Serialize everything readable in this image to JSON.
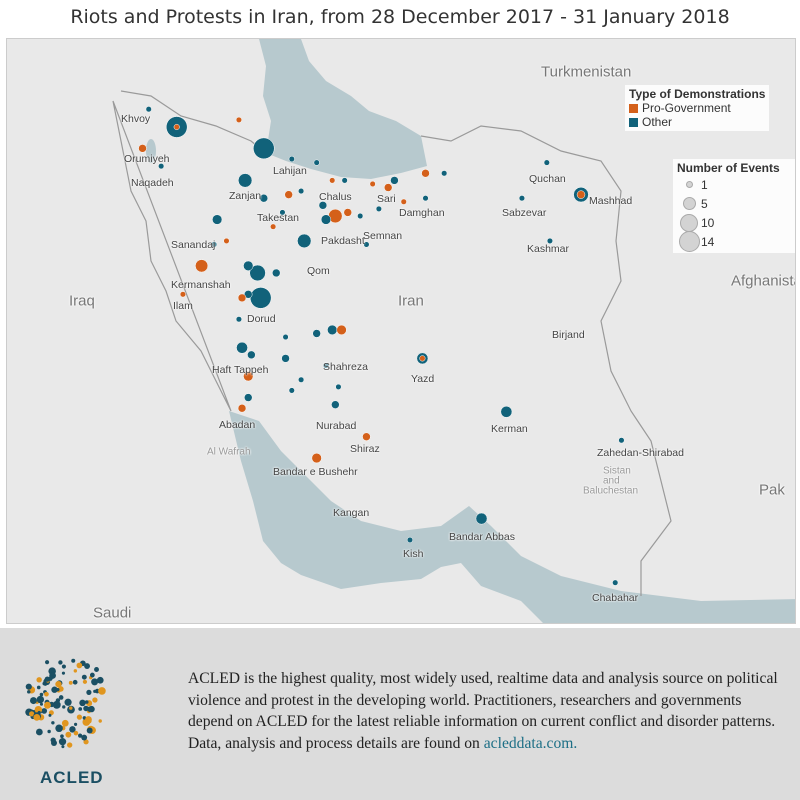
{
  "title": "Riots and Protests in Iran, from 28 December 2017 - 31 January 2018",
  "colors": {
    "pro_government": "#d4601a",
    "other": "#11627a",
    "water": "#b7c9ce",
    "land": "#e9e9e9"
  },
  "legend_type": {
    "title": "Type of Demonstrations",
    "items": [
      {
        "label": "Pro-Government",
        "key": "pro_government"
      },
      {
        "label": "Other",
        "key": "other"
      }
    ]
  },
  "legend_size": {
    "title": "Number of Events",
    "items": [
      {
        "label": "1",
        "value": 1
      },
      {
        "label": "5",
        "value": 5
      },
      {
        "label": "10",
        "value": 10
      },
      {
        "label": "14",
        "value": 14
      }
    ]
  },
  "labels": {
    "countries": [
      "Iraq",
      "Iran",
      "Saudi",
      "Pak",
      "Afghanista",
      "Turkmenistan"
    ],
    "regions": [
      "Al Wafrah",
      "Sistan",
      "and",
      "Baluchestan"
    ],
    "cities": [
      "Khvoy",
      "Orumiyeh",
      "Naqadeh",
      "Lahijan",
      "Zanjan",
      "Chalus",
      "Sari",
      "Damghan",
      "Takestan",
      "Pakdasht",
      "Semnan",
      "Sanandaj",
      "Qom",
      "Kermanshah",
      "Ilam",
      "Dorud",
      "Haft Tappeh",
      "Shahreza",
      "Yazd",
      "Abadan",
      "Nurabad",
      "Shiraz",
      "Bandar e Bushehr",
      "Kerman",
      "Zahedan-Shirabad",
      "Kangan",
      "Bandar Abbas",
      "Kish",
      "Chabahar",
      "Quchan",
      "Sabzevar",
      "Mashhad",
      "Kashmar",
      "Birjand"
    ]
  },
  "events": [
    {
      "lon": 46.6,
      "lat": 38.2,
      "type": "other",
      "count": 14
    },
    {
      "lon": 49.4,
      "lat": 37.6,
      "type": "other",
      "count": 14
    },
    {
      "lon": 49.3,
      "lat": 33.4,
      "type": "other",
      "count": 14
    },
    {
      "lon": 49.2,
      "lat": 34.1,
      "type": "other",
      "count": 8
    },
    {
      "lon": 48.8,
      "lat": 36.7,
      "type": "other",
      "count": 6
    },
    {
      "lon": 47.4,
      "lat": 34.3,
      "type": "pro_government",
      "count": 5
    },
    {
      "lon": 59.6,
      "lat": 36.3,
      "type": "other",
      "count": 7
    },
    {
      "lon": 51.7,
      "lat": 35.7,
      "type": "pro_government",
      "count": 6
    },
    {
      "lon": 50.7,
      "lat": 35.0,
      "type": "other",
      "count": 6
    },
    {
      "lon": 56.4,
      "lat": 27.2,
      "type": "other",
      "count": 4
    },
    {
      "lon": 57.2,
      "lat": 30.2,
      "type": "other",
      "count": 4
    },
    {
      "lon": 54.5,
      "lat": 31.7,
      "type": "other",
      "count": 4
    },
    {
      "lon": 51.6,
      "lat": 32.5,
      "type": "other",
      "count": 3
    },
    {
      "lon": 51.9,
      "lat": 32.5,
      "type": "pro_government",
      "count": 3
    },
    {
      "lon": 47.9,
      "lat": 35.6,
      "type": "other",
      "count": 3
    },
    {
      "lon": 48.9,
      "lat": 34.3,
      "type": "other",
      "count": 3
    },
    {
      "lon": 49.8,
      "lat": 34.1,
      "type": "other",
      "count": 2
    },
    {
      "lon": 48.7,
      "lat": 32.0,
      "type": "other",
      "count": 4
    },
    {
      "lon": 49.0,
      "lat": 31.8,
      "type": "other",
      "count": 2
    },
    {
      "lon": 50.1,
      "lat": 31.7,
      "type": "other",
      "count": 2
    },
    {
      "lon": 48.9,
      "lat": 31.2,
      "type": "pro_government",
      "count": 3
    },
    {
      "lon": 48.9,
      "lat": 30.6,
      "type": "other",
      "count": 2
    },
    {
      "lon": 48.7,
      "lat": 30.3,
      "type": "pro_government",
      "count": 2
    },
    {
      "lon": 51.7,
      "lat": 30.4,
      "type": "other",
      "count": 2
    },
    {
      "lon": 52.7,
      "lat": 29.5,
      "type": "pro_government",
      "count": 2
    },
    {
      "lon": 51.1,
      "lat": 28.9,
      "type": "pro_government",
      "count": 3
    },
    {
      "lon": 51.8,
      "lat": 30.9,
      "type": "other",
      "count": 1
    },
    {
      "lon": 51.1,
      "lat": 32.4,
      "type": "other",
      "count": 2
    },
    {
      "lon": 50.3,
      "lat": 30.8,
      "type": "other",
      "count": 1
    },
    {
      "lon": 53.6,
      "lat": 36.7,
      "type": "other",
      "count": 2
    },
    {
      "lon": 53.4,
      "lat": 36.5,
      "type": "pro_government",
      "count": 2
    },
    {
      "lon": 52.9,
      "lat": 36.6,
      "type": "pro_government",
      "count": 1
    },
    {
      "lon": 53.9,
      "lat": 36.1,
      "type": "pro_government",
      "count": 1
    },
    {
      "lon": 54.6,
      "lat": 36.2,
      "type": "other",
      "count": 1
    },
    {
      "lon": 54.6,
      "lat": 36.9,
      "type": "pro_government",
      "count": 2
    },
    {
      "lon": 55.2,
      "lat": 36.9,
      "type": "other",
      "count": 1
    },
    {
      "lon": 58.5,
      "lat": 37.2,
      "type": "other",
      "count": 1
    },
    {
      "lon": 57.7,
      "lat": 36.2,
      "type": "other",
      "count": 1
    },
    {
      "lon": 58.6,
      "lat": 35.0,
      "type": "other",
      "count": 1
    },
    {
      "lon": 60.9,
      "lat": 29.4,
      "type": "other",
      "count": 1
    },
    {
      "lon": 54.1,
      "lat": 26.6,
      "type": "other",
      "count": 1
    },
    {
      "lon": 60.7,
      "lat": 25.4,
      "type": "other",
      "count": 1
    },
    {
      "lon": 45.5,
      "lat": 37.6,
      "type": "pro_government",
      "count": 2
    },
    {
      "lon": 45.7,
      "lat": 38.7,
      "type": "other",
      "count": 1
    },
    {
      "lon": 46.1,
      "lat": 37.1,
      "type": "other",
      "count": 1
    },
    {
      "lon": 48.6,
      "lat": 38.4,
      "type": "pro_government",
      "count": 1
    },
    {
      "lon": 50.3,
      "lat": 37.3,
      "type": "other",
      "count": 1
    },
    {
      "lon": 51.1,
      "lat": 37.2,
      "type": "other",
      "count": 1
    },
    {
      "lon": 51.6,
      "lat": 36.7,
      "type": "pro_government",
      "count": 1
    },
    {
      "lon": 52.0,
      "lat": 36.7,
      "type": "other",
      "count": 1
    },
    {
      "lon": 50.2,
      "lat": 36.3,
      "type": "pro_government",
      "count": 2
    },
    {
      "lon": 49.4,
      "lat": 36.2,
      "type": "other",
      "count": 2
    },
    {
      "lon": 50.6,
      "lat": 36.4,
      "type": "other",
      "count": 1
    },
    {
      "lon": 50.0,
      "lat": 35.8,
      "type": "other",
      "count": 1
    },
    {
      "lon": 51.3,
      "lat": 36.0,
      "type": "other",
      "count": 2
    },
    {
      "lon": 51.4,
      "lat": 35.6,
      "type": "other",
      "count": 3
    },
    {
      "lon": 52.1,
      "lat": 35.8,
      "type": "pro_government",
      "count": 2
    },
    {
      "lon": 52.5,
      "lat": 35.7,
      "type": "other",
      "count": 1
    },
    {
      "lon": 52.7,
      "lat": 34.9,
      "type": "other",
      "count": 1
    },
    {
      "lon": 53.1,
      "lat": 35.9,
      "type": "other",
      "count": 1
    },
    {
      "lon": 49.7,
      "lat": 35.4,
      "type": "pro_government",
      "count": 1
    },
    {
      "lon": 48.2,
      "lat": 35.0,
      "type": "pro_government",
      "count": 1
    },
    {
      "lon": 48.9,
      "lat": 33.5,
      "type": "other",
      "count": 2
    },
    {
      "lon": 48.7,
      "lat": 33.4,
      "type": "pro_government",
      "count": 2
    },
    {
      "lon": 46.8,
      "lat": 33.5,
      "type": "pro_government",
      "count": 1
    },
    {
      "lon": 47.8,
      "lat": 34.9,
      "type": "other",
      "count": 1
    },
    {
      "lon": 48.6,
      "lat": 32.8,
      "type": "other",
      "count": 1
    },
    {
      "lon": 50.1,
      "lat": 32.3,
      "type": "other",
      "count": 1
    },
    {
      "lon": 51.4,
      "lat": 31.5,
      "type": "other",
      "count": 1
    },
    {
      "lon": 50.6,
      "lat": 31.1,
      "type": "other",
      "count": 1
    },
    {
      "lon": 46.6,
      "lat": 38.2,
      "type": "pro_government",
      "count": 1
    },
    {
      "lon": 59.6,
      "lat": 36.3,
      "type": "pro_government",
      "count": 2
    },
    {
      "lon": 54.5,
      "lat": 31.7,
      "type": "pro_government",
      "count": 1
    }
  ],
  "footer": {
    "logo_text": "ACLED",
    "text": "ACLED is the highest quality, most widely used, realtime data and analysis source on political violence and protest in the developing world. Practitioners, researchers and governments depend on ACLED for the latest reliable information on current conflict and disorder patterns. Data, analysis and process details are found on ",
    "link": "acleddata.com."
  }
}
